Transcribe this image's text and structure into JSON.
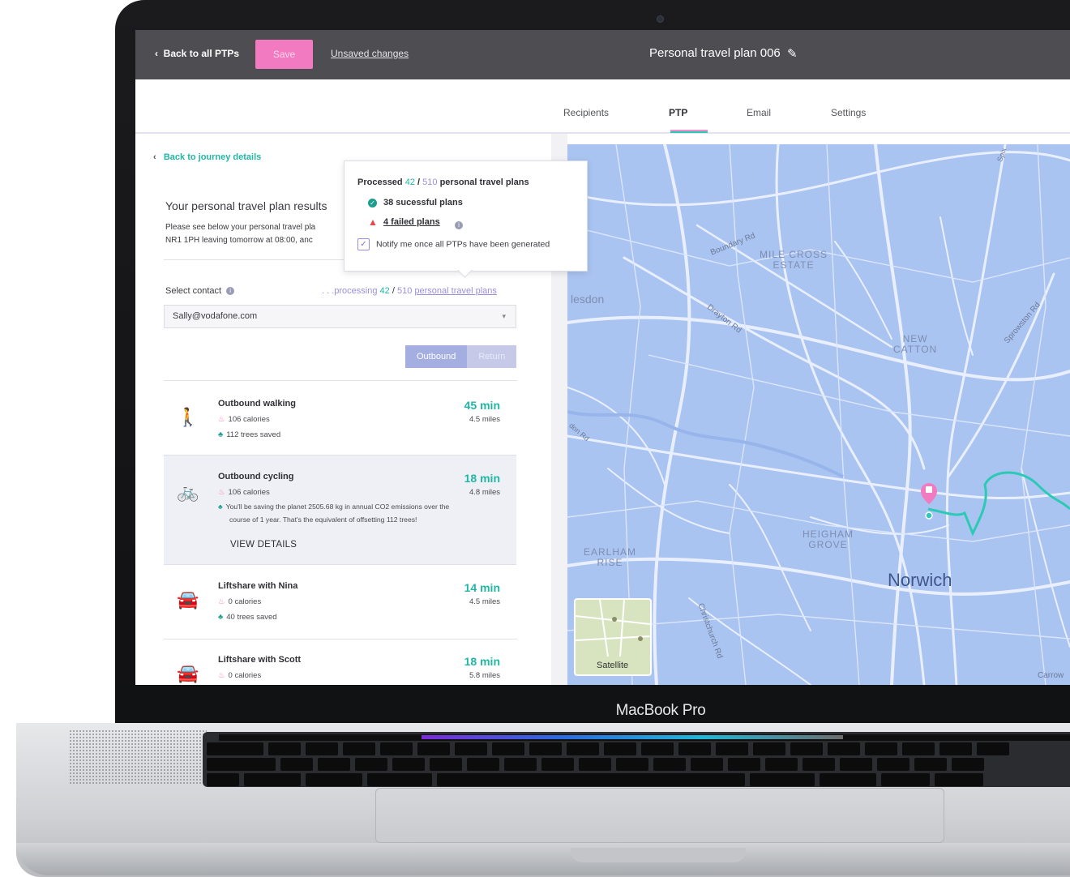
{
  "device": {
    "brand_label": "MacBook Pro"
  },
  "topbar": {
    "back_label": "Back to all PTPs",
    "save_label": "Save",
    "unsaved_label": "Unsaved changes",
    "plan_title": "Personal travel plan 006"
  },
  "tabs": [
    {
      "label": "Recipients",
      "active": false
    },
    {
      "label": "PTP",
      "active": true
    },
    {
      "label": "Email",
      "active": false
    },
    {
      "label": "Settings",
      "active": false
    }
  ],
  "left": {
    "back_journey": "Back to journey details",
    "results_title": "Your personal travel plan results",
    "results_desc_line1": "Please see below your personal travel pla",
    "results_desc_line2": "NR1 1PH leaving tomorrow at 08:00, anc",
    "select_label": "Select contact",
    "processing_prefix": ". . .processing",
    "processing_done": "42",
    "processing_sep": "/",
    "processing_total": "510",
    "processing_suffix": "personal travel plans",
    "contact_value": "Sally@vodafone.com",
    "toggle_outbound": "Outbound",
    "toggle_return": "Return"
  },
  "popup": {
    "head_prefix": "Processed",
    "head_done": "42",
    "head_sep": "/",
    "head_total": "510",
    "head_suffix": "personal travel plans",
    "successful": "38 sucessful plans",
    "failed": "4 failed plans",
    "notify": "Notify me once all PTPs have been generated",
    "notify_checked": true
  },
  "journeys": [
    {
      "icon": "walking-icon",
      "title": "Outbound walking",
      "calories": "106 calories",
      "trees": "112 trees saved",
      "time": "45 min",
      "distance": "4.5 miles"
    },
    {
      "icon": "cycling-icon",
      "title": "Outbound cycling",
      "calories": "106 calories",
      "trees_line1": "You'll be saving the planet 2505.68 kg in annual CO2 emissions over the",
      "trees_line2": "course of 1 year. That's the equivalent of offsetting 112 trees!",
      "time": "18 min",
      "distance": "4.8 miles",
      "action": "VIEW DETAILS"
    },
    {
      "icon": "car-icon",
      "title": "Liftshare with Nina",
      "calories": "0 calories",
      "trees": "40 trees saved",
      "time": "14 min",
      "distance": "4.5 miles"
    },
    {
      "icon": "car-icon",
      "title": "Liftshare with Scott",
      "calories": "0 calories",
      "time": "18 min",
      "distance": "5.8 miles"
    }
  ],
  "map": {
    "labels": {
      "boundary": "Boundary Rd",
      "mile_cross_1": "MILE CROSS",
      "mile_cross_2": "ESTATE",
      "drayton": "Drayton Rd",
      "sprowston": "Sprowston Rd",
      "new_catton_1": "NEW",
      "new_catton_2": "CATTON",
      "hellesdon": "lesdon",
      "heigham_1": "HEIGHAM",
      "heigham_2": "GROVE",
      "earlham_1": "EARLHAM",
      "earlham_2": "RISE",
      "norwich": "Norwich",
      "christchurch": "Christchurch Rd",
      "don_rd": "don Rd",
      "carrow": "Carrow",
      "spix": "Spix"
    },
    "satellite_label": "Satellite",
    "colors": {
      "water": "#aac4f2",
      "road": "#e9efff",
      "route": "#2cc9b5",
      "pin": "#f27ac0"
    }
  }
}
